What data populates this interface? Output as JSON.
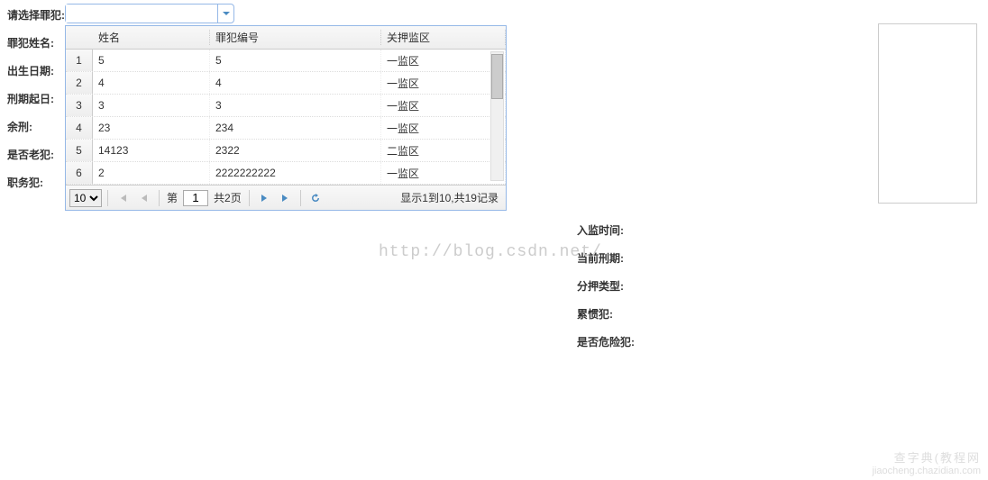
{
  "selector_label": "请选择罪犯:",
  "left_labels": [
    "罪犯姓名:",
    "出生日期:",
    "刑期起日:",
    "余刑:",
    "是否老犯:",
    "职务犯:"
  ],
  "right_labels": [
    "入监时间:",
    "当前刑期:",
    "分押类型:",
    "累惯犯:",
    "是否危险犯:"
  ],
  "grid": {
    "headers": {
      "name": "姓名",
      "code": "罪犯编号",
      "area": "关押监区"
    },
    "rows": [
      {
        "n": "1",
        "name": "5",
        "code": "5",
        "area": "一监区"
      },
      {
        "n": "2",
        "name": "4",
        "code": "4",
        "area": "一监区"
      },
      {
        "n": "3",
        "name": "3",
        "code": "3",
        "area": "一监区"
      },
      {
        "n": "4",
        "name": "23",
        "code": "234",
        "area": "一监区"
      },
      {
        "n": "5",
        "name": "14123",
        "code": "2322",
        "area": "二监区"
      },
      {
        "n": "6",
        "name": "2",
        "code": "2222222222",
        "area": "一监区"
      }
    ]
  },
  "pager": {
    "page_size": "10",
    "page_label_prefix": "第",
    "current_page": "1",
    "total_pages_text": "共2页",
    "info": "显示1到10,共19记录"
  },
  "watermark": "http://blog.csdn.net/",
  "footer": {
    "line1": "查字典(教程网",
    "line2": "jiaocheng.chazidian.com"
  }
}
